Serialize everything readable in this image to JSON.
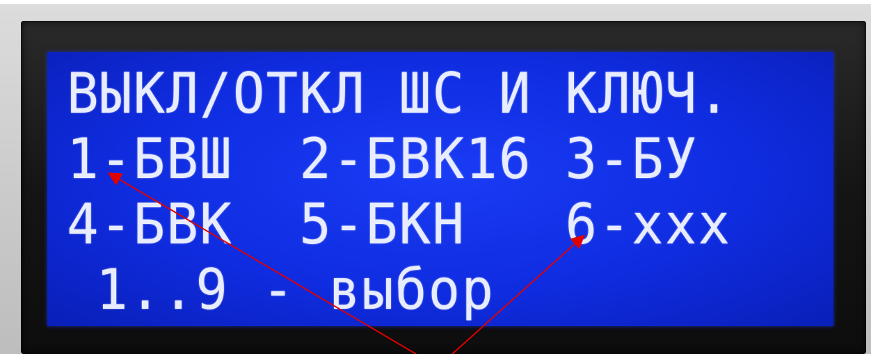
{
  "lcd": {
    "lines": [
      "ВЫКЛ/ОТКЛ ШС И КЛЮЧ.",
      "1-БВШ  2-БВК16 3-БУ",
      "4-БВК  5-БКН   6-xxx",
      "1..9 - выбор"
    ]
  },
  "colors": {
    "backlight": "#1a3cf5",
    "text": "#e8ecff",
    "bezel": "#151515",
    "arrow": "#e00000"
  }
}
